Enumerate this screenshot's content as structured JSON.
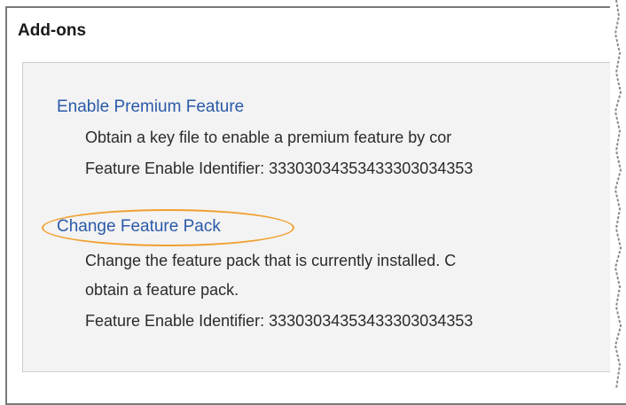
{
  "section": {
    "title": "Add-ons"
  },
  "items": [
    {
      "link_label": "Enable Premium Feature",
      "description_lines": [
        "Obtain a key file to enable a premium feature by cor",
        "Feature Enable Identifier: 33303034353433303034353"
      ]
    },
    {
      "link_label": "Change Feature Pack",
      "description_lines": [
        "Change the feature pack that is currently installed. C",
        "obtain a feature pack.",
        "Feature Enable Identifier: 33303034353433303034353"
      ]
    }
  ],
  "colors": {
    "link": "#2a5aa8",
    "highlight": "#f0a030",
    "panel_bg": "#f3f3f3"
  }
}
